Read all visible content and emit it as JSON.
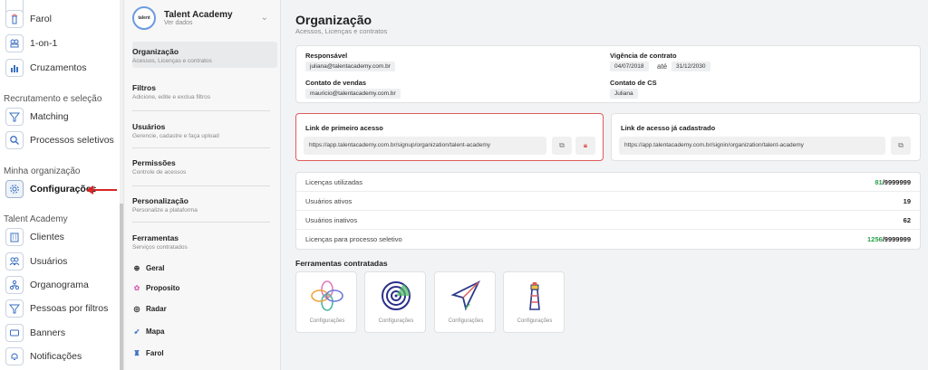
{
  "leftnav": {
    "items_top": [
      {
        "label": "Farol",
        "icon": "lighthouse-icon"
      },
      {
        "label": "1-on-1",
        "icon": "people-icon"
      },
      {
        "label": "Cruzamentos",
        "icon": "chart-icon"
      }
    ],
    "section_recruit": "Recrutamento e seleção",
    "items_recruit": [
      {
        "label": "Matching",
        "icon": "funnel-icon"
      },
      {
        "label": "Processos seletivos",
        "icon": "search-icon"
      }
    ],
    "section_org": "Minha organização",
    "item_config": {
      "label": "Configurações",
      "icon": "gear-icon"
    },
    "section_ta": "Talent Academy",
    "items_ta": [
      {
        "label": "Clientes",
        "icon": "building-icon"
      },
      {
        "label": "Usuários",
        "icon": "users-icon"
      },
      {
        "label": "Organograma",
        "icon": "org-chart-icon"
      },
      {
        "label": "Pessoas por filtros",
        "icon": "filter-icon"
      },
      {
        "label": "Banners",
        "icon": "banner-icon"
      },
      {
        "label": "Notificações",
        "icon": "bell-icon"
      }
    ]
  },
  "midpanel": {
    "org_name": "Talent Academy",
    "org_sub": "Ver dados",
    "org_logo_text": "talent",
    "menu": [
      {
        "title": "Organização",
        "sub": "Acessos, Licenças e contratos"
      },
      {
        "title": "Filtros",
        "sub": "Adicione, edite e exclua filtros"
      },
      {
        "title": "Usuários",
        "sub": "Gerencie, cadastre e faça upload"
      },
      {
        "title": "Permissões",
        "sub": "Controle de acessos"
      },
      {
        "title": "Personalização",
        "sub": "Personalize a plataforma"
      },
      {
        "title": "Ferramentas",
        "sub": "Serviços contratados"
      }
    ],
    "tools": [
      {
        "label": "Geral",
        "icon": "globe-icon"
      },
      {
        "label": "Proposito",
        "icon": "flower-icon"
      },
      {
        "label": "Radar",
        "icon": "radar-icon"
      },
      {
        "label": "Mapa",
        "icon": "paper-plane-icon"
      },
      {
        "label": "Farol",
        "icon": "lighthouse-icon"
      }
    ]
  },
  "main": {
    "title": "Organização",
    "subtitle": "Acessos, Licenças e contratos",
    "contacts": {
      "responsavel_label": "Responsável",
      "responsavel_value": "juliana@talentacademy.com.br",
      "vigencia_label": "Vigência de contrato",
      "vigencia_start": "04/07/2018",
      "vigencia_sep": "até",
      "vigencia_end": "31/12/2030",
      "vendas_label": "Contato de vendas",
      "vendas_value": "mauricio@talentacademy.com.br",
      "cs_label": "Contato de CS",
      "cs_value": "Juliana"
    },
    "first_access": {
      "label": "Link de primeiro acesso",
      "url": "https://app.talentacademy.com.br/signup/organization/talent-academy"
    },
    "registered_access": {
      "label": "Link de acesso já cadastrado",
      "url": "https://app.talentacademy.com.br/signin/organization/talent-academy"
    },
    "licenses": [
      {
        "label": "Licenças utilizadas",
        "used": "81",
        "total": "/9999999"
      },
      {
        "label": "Usuários ativos",
        "value": "19"
      },
      {
        "label": "Usuários inativos",
        "value": "62"
      },
      {
        "label": "Licenças para processo seletivo",
        "used": "1256",
        "total": "/9999999"
      }
    ],
    "tools_title": "Ferramentas contratadas",
    "tool_cards": [
      {
        "label": "Configurações",
        "icon": "flower-icon"
      },
      {
        "label": "Configurações",
        "icon": "radar-icon"
      },
      {
        "label": "Configurações",
        "icon": "paper-plane-icon"
      },
      {
        "label": "Configurações",
        "icon": "lighthouse-icon"
      }
    ]
  },
  "colors": {
    "accent_red": "#d72626",
    "license_green": "#2aa24a",
    "first_access_border": "#e05b5b"
  }
}
